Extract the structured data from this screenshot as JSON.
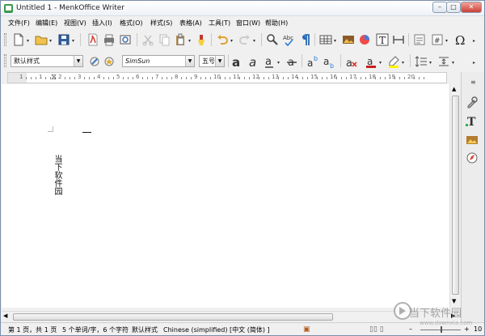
{
  "window": {
    "title": "Untitled 1 - MenkOffice Writer"
  },
  "menu": [
    "文件(F)",
    "编辑(E)",
    "视图(V)",
    "插入(I)",
    "格式(O)",
    "样式(S)",
    "表格(A)",
    "工具(T)",
    "窗口(W)",
    "帮助(H)"
  ],
  "formatting": {
    "paragraph_style": "默认样式",
    "font_name": "SimSun",
    "font_size": "五号"
  },
  "ruler_labels": [
    "1",
    "1",
    "2",
    "3",
    "4",
    "5",
    "6",
    "7",
    "8",
    "9",
    "10",
    "11",
    "12",
    "13",
    "14",
    "15",
    "16",
    "17",
    "18",
    "19",
    "20"
  ],
  "document": {
    "vertical_text": "当下软件园"
  },
  "status": {
    "page": "第 1 页，共 1 页",
    "words": "5 个单词/字，6 个字符",
    "style": "默认样式",
    "language": "Chinese (simplified) [中文 (简体) ]",
    "zoom": "10"
  },
  "watermark": {
    "name": "当下软件园",
    "url": "www.downxia.com"
  }
}
